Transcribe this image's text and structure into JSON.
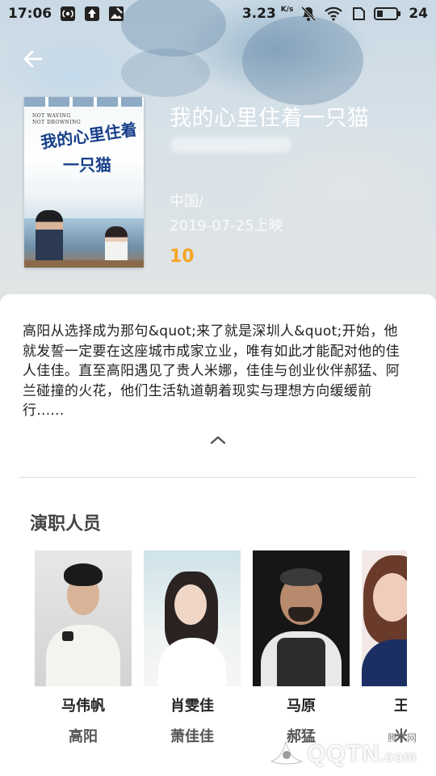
{
  "status_bar": {
    "time": "17:06",
    "net_speed": "3.23",
    "net_speed_unit": "K/s",
    "battery": "24",
    "icons": [
      "cast-icon",
      "upload-icon",
      "image-icon",
      "mute-icon",
      "wifi-icon",
      "sim-icon",
      "battery-icon"
    ]
  },
  "nav": {
    "back_icon": "arrow-left-icon"
  },
  "movie": {
    "title": "我的心里住着一只猫",
    "region": "中国/",
    "release_date": "2019-07-25上映",
    "rating": "10",
    "poster": {
      "tagline": "NOT WAVING\nNOT DROWNING",
      "title_line1": "我的心里住着",
      "title_line2": "一只猫"
    }
  },
  "synopsis": {
    "text": "高阳从选择成为那句&quot;来了就是深圳人&quot;开始，他就发誓一定要在这座城市成家立业，唯有如此才能配对他的佳人佳佳。直至高阳遇见了贵人米娜，佳佳与创业伙伴郝猛、阿兰碰撞的火花，他们生活轨道朝着现实与理想方向缓缓前行......",
    "collapse_icon": "chevron-up-icon"
  },
  "cast": {
    "heading": "演职人员",
    "members": [
      {
        "name": "马伟帆",
        "role": "高阳"
      },
      {
        "name": "肖雯佳",
        "role": "萧佳佳"
      },
      {
        "name": "马原",
        "role": "郝猛"
      },
      {
        "name": "王",
        "role": "米"
      }
    ]
  },
  "watermark": {
    "text": "QQTN",
    "suffix": ".com",
    "label": "腾牛网"
  },
  "colors": {
    "rating": "#f5a623",
    "title": "#ffffff",
    "card": "#ffffff"
  }
}
